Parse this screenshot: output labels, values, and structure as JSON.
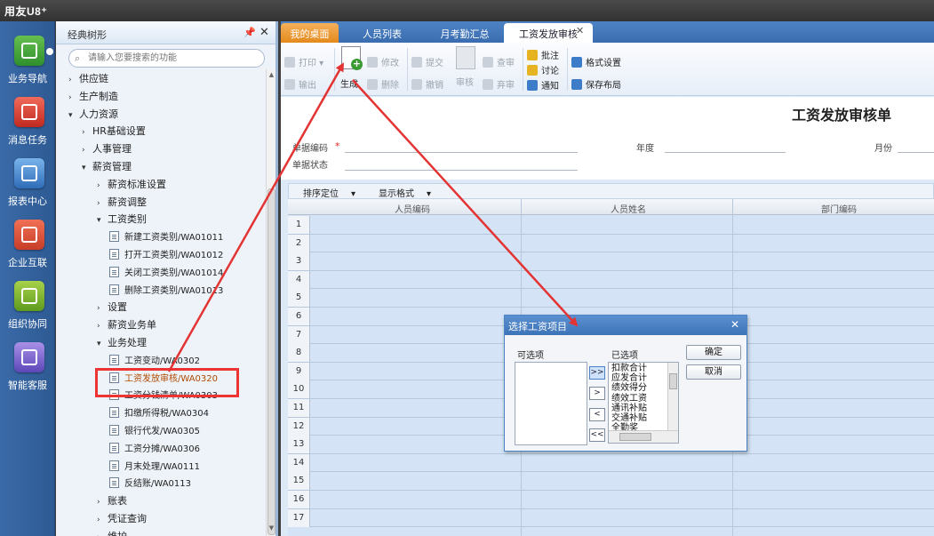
{
  "app": {
    "brand": "用友U8⁺"
  },
  "nav": [
    {
      "label": "业务导航",
      "icon": "business-navigation-icon"
    },
    {
      "label": "消息任务",
      "icon": "message-task-icon"
    },
    {
      "label": "报表中心",
      "icon": "report-center-icon"
    },
    {
      "label": "企业互联",
      "icon": "enterprise-connect-icon"
    },
    {
      "label": "组织协同",
      "icon": "org-collaboration-icon"
    },
    {
      "label": "智能客服",
      "icon": "smart-service-icon"
    }
  ],
  "tree": {
    "title": "经典树形",
    "search_placeholder": "请输入您要搜索的功能",
    "nodes": [
      {
        "label": "供应链",
        "state": "collapsed",
        "level": 1
      },
      {
        "label": "生产制造",
        "state": "collapsed",
        "level": 1
      },
      {
        "label": "人力资源",
        "state": "expanded",
        "level": 1
      },
      {
        "label": "HR基础设置",
        "state": "collapsed",
        "level": 2
      },
      {
        "label": "人事管理",
        "state": "collapsed",
        "level": 2
      },
      {
        "label": "薪资管理",
        "state": "expanded",
        "level": 2
      },
      {
        "label": "薪资标准设置",
        "state": "collapsed",
        "level": 3
      },
      {
        "label": "薪资调整",
        "state": "collapsed",
        "level": 3
      },
      {
        "label": "工资类别",
        "state": "expanded",
        "level": 3
      },
      {
        "label": "新建工资类别/WA01011",
        "state": "leaf",
        "level": 4
      },
      {
        "label": "打开工资类别/WA01012",
        "state": "leaf",
        "level": 4
      },
      {
        "label": "关闭工资类别/WA01014",
        "state": "leaf",
        "level": 4
      },
      {
        "label": "删除工资类别/WA01013",
        "state": "leaf",
        "level": 4
      },
      {
        "label": "设置",
        "state": "collapsed",
        "level": 3
      },
      {
        "label": "薪资业务单",
        "state": "collapsed",
        "level": 3
      },
      {
        "label": "业务处理",
        "state": "expanded",
        "level": 3
      },
      {
        "label": "工资变动/WA0302",
        "state": "leaf",
        "level": 4
      },
      {
        "label": "工资发放审核/WA0320",
        "state": "leaf",
        "level": 4,
        "selected": true
      },
      {
        "label": "工资分钱清单/WA0303",
        "state": "leaf",
        "level": 4
      },
      {
        "label": "扣缴所得税/WA0304",
        "state": "leaf",
        "level": 4
      },
      {
        "label": "银行代发/WA0305",
        "state": "leaf",
        "level": 4
      },
      {
        "label": "工资分摊/WA0306",
        "state": "leaf",
        "level": 4
      },
      {
        "label": "月末处理/WA0111",
        "state": "leaf",
        "level": 4
      },
      {
        "label": "反结账/WA0113",
        "state": "leaf",
        "level": 4
      },
      {
        "label": "账表",
        "state": "collapsed",
        "level": 3
      },
      {
        "label": "凭证查询",
        "state": "collapsed",
        "level": 3
      },
      {
        "label": "维护",
        "state": "collapsed",
        "level": 3
      }
    ]
  },
  "tabs": [
    {
      "label": "我的桌面"
    },
    {
      "label": "人员列表"
    },
    {
      "label": "月考勤汇总"
    },
    {
      "label": "工资发放审核",
      "active": true
    }
  ],
  "toolbar": {
    "print": "打印",
    "export": "输出",
    "generate": "生成",
    "modify": "修改",
    "delete": "删除",
    "submit": "提交",
    "revoke": "撤销",
    "audit": "审核",
    "view_audit": "查审",
    "abandon_audit": "弃审",
    "annotate": "批注",
    "discuss": "讨论",
    "notify": "通知",
    "format_settings": "格式设置",
    "save_layout": "保存布局"
  },
  "form": {
    "title": "工资发放审核单",
    "doc_code_label": "单据编码",
    "doc_status_label": "单据状态",
    "year_label": "年度",
    "month_label": "月份"
  },
  "grid": {
    "sort_locate": "排序定位",
    "display_format": "显示格式",
    "columns": [
      "人员编码",
      "人员姓名",
      "部门编码"
    ],
    "row_numbers": [
      "1",
      "2",
      "3",
      "4",
      "5",
      "6",
      "7",
      "8",
      "9",
      "10",
      "11",
      "12",
      "13",
      "14",
      "15",
      "16",
      "17"
    ]
  },
  "dialog": {
    "title": "选择工资项目",
    "available_label": "可选项",
    "selected_label": "已选项",
    "move_buttons": [
      ">>",
      ">",
      "<",
      "<<"
    ],
    "selected_items": [
      "扣款合计",
      "应发合计",
      "绩效得分",
      "绩效工资",
      "通讯补贴",
      "交通补贴",
      "全勤奖"
    ],
    "ok": "确定",
    "cancel": "取消"
  },
  "colors": {
    "active_tab_orange": "#e48a1c",
    "highlight_red": "#e33333",
    "selected_tree_text": "#b04a00",
    "tabbar_blue": "#3a6db0"
  }
}
